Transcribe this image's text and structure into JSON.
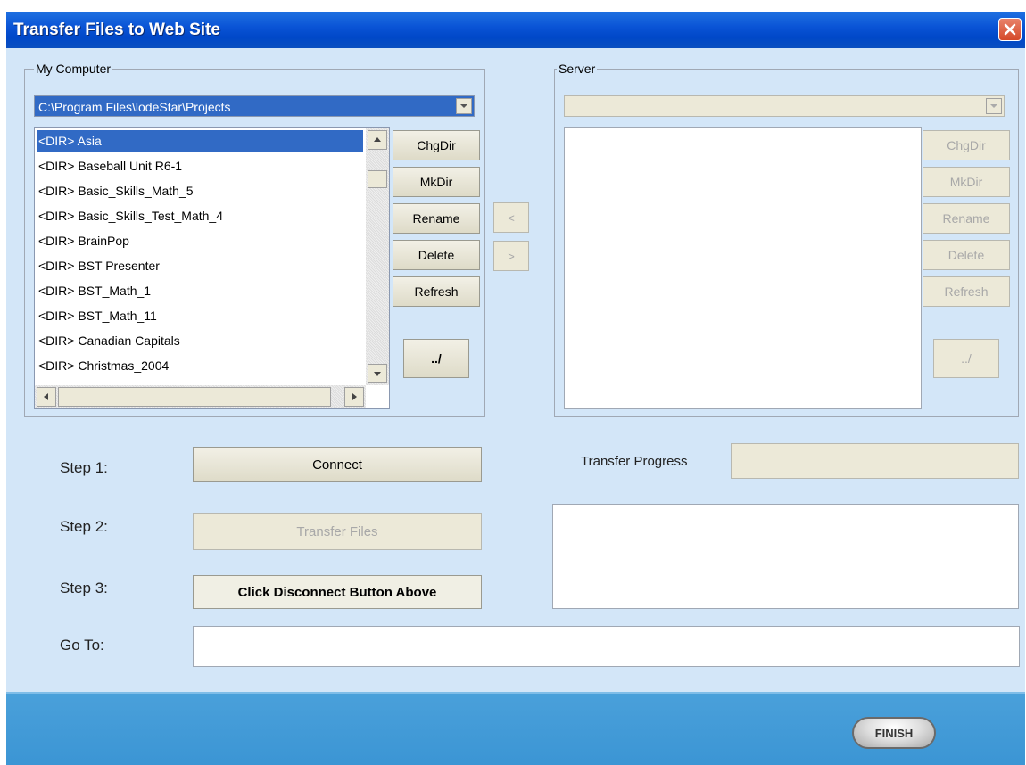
{
  "window": {
    "title": "Transfer Files to Web Site"
  },
  "local": {
    "legend": "My Computer",
    "path": "C:\\Program Files\\lodeStar\\Projects",
    "items": [
      "<DIR> Asia",
      "<DIR> Baseball Unit R6-1",
      "<DIR> Basic_Skills_Math_5",
      "<DIR> Basic_Skills_Test_Math_4",
      "<DIR> BrainPop",
      "<DIR> BST Presenter",
      "<DIR> BST_Math_1",
      "<DIR> BST_Math_11",
      "<DIR> Canadian Capitals",
      "<DIR> Christmas_2004"
    ],
    "selected_index": 0,
    "buttons": {
      "chgdir": "ChgDir",
      "mkdir": "MkDir",
      "rename": "Rename",
      "delete": "Delete",
      "refresh": "Refresh",
      "up": "../"
    }
  },
  "transfer_arrows": {
    "to_local": "<",
    "to_server": ">"
  },
  "server": {
    "legend": "Server",
    "path": "",
    "buttons": {
      "chgdir": "ChgDir",
      "mkdir": "MkDir",
      "rename": "Rename",
      "delete": "Delete",
      "refresh": "Refresh",
      "up": "../"
    }
  },
  "steps": {
    "step1_label": "Step 1:",
    "step1_button": "Connect",
    "step2_label": "Step 2:",
    "step2_button": "Transfer Files",
    "step3_label": "Step 3:",
    "step3_button": "Click Disconnect Button Above",
    "goto_label": "Go To:",
    "goto_value": ""
  },
  "progress": {
    "label": "Transfer Progress"
  },
  "footer": {
    "finish_label": "FINISH"
  },
  "colors": {
    "title_bar": "#0a54d6",
    "selection": "#316ac5",
    "panel_bg": "#d3e6f8",
    "footer_bg": "#3b95d4"
  }
}
